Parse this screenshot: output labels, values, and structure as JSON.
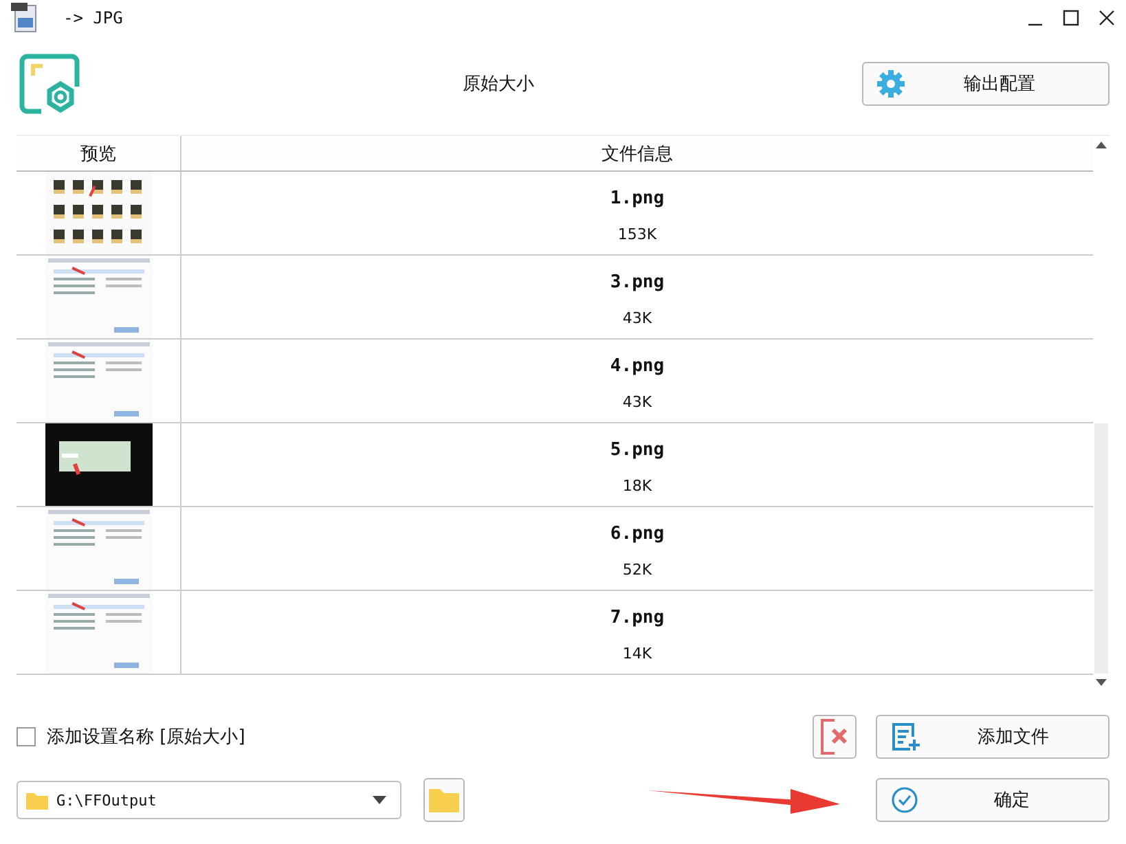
{
  "window": {
    "title": "-> JPG"
  },
  "header": {
    "preset": "原始大小",
    "config_button": "输出配置"
  },
  "table": {
    "columns": [
      "预览",
      "文件信息"
    ],
    "rows": [
      {
        "name": "1.png",
        "size": "153K"
      },
      {
        "name": "3.png",
        "size": "43K"
      },
      {
        "name": "4.png",
        "size": "43K"
      },
      {
        "name": "5.png",
        "size": "18K"
      },
      {
        "name": "6.png",
        "size": "52K"
      },
      {
        "name": "7.png",
        "size": "14K"
      }
    ]
  },
  "options": {
    "label": "添加设置名称 [原始大小]",
    "checked": false
  },
  "add_button": "添加文件",
  "output": {
    "path": "G:\\FFOutput"
  },
  "confirm_button": "确定"
}
